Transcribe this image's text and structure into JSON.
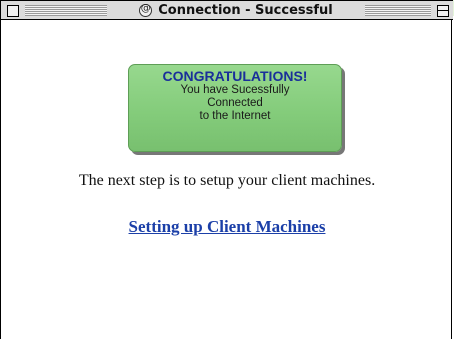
{
  "window": {
    "title": "Connection - Successful"
  },
  "banner": {
    "heading": "CONGRATULATIONS!",
    "lines": [
      "You have Sucessfully",
      "Connected",
      "to the Internet"
    ]
  },
  "content": {
    "instruction": "The next step is to setup your client machines.",
    "link_label": "Setting up Client Machines"
  },
  "colors": {
    "banner_green": "#84cc7b",
    "heading_blue": "#1a2f9a",
    "link_blue": "#1b3fa8",
    "titlebar_gray": "#dcdcdc"
  }
}
